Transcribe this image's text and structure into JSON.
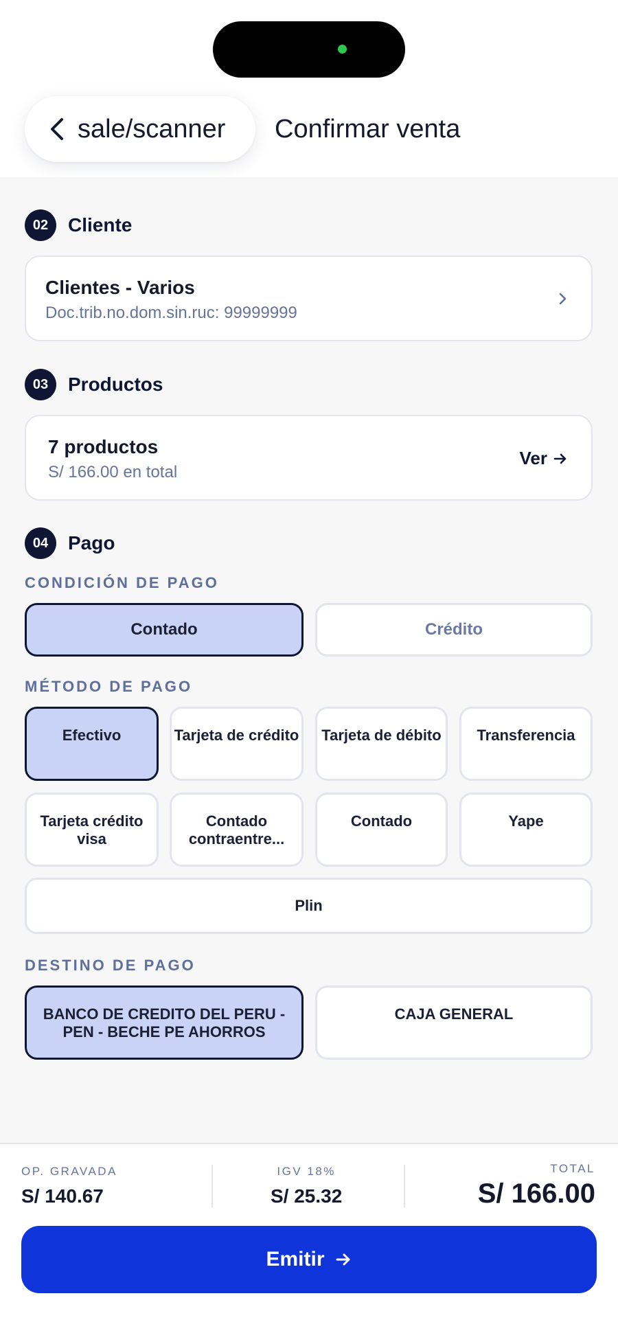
{
  "header": {
    "back_label": "sale/scanner",
    "title": "Confirmar venta"
  },
  "cliente": {
    "step": "02",
    "label": "Cliente",
    "name": "Clientes - Varios",
    "doc": "Doc.trib.no.dom.sin.ruc: 99999999"
  },
  "productos": {
    "step": "03",
    "label": "Productos",
    "count": "7 productos",
    "total": "S/ 166.00 en total",
    "ver": "Ver"
  },
  "pago": {
    "step": "04",
    "label": "Pago",
    "condicion_label": "CONDICIÓN DE PAGO",
    "condiciones": [
      "Contado",
      "Crédito"
    ],
    "condicion_selected": "Contado",
    "metodo_label": "MÉTODO DE PAGO",
    "metodos": [
      "Efectivo",
      "Tarjeta de crédito",
      "Tarjeta de débito",
      "Transferencia",
      "Tarjeta crédito visa",
      "Contado contraentre...",
      "Contado",
      "Yape",
      "Plin"
    ],
    "metodo_selected": "Efectivo",
    "destino_label": "DESTINO DE PAGO",
    "destinos": [
      "BANCO DE CREDITO DEL PERU - PEN - BECHE PE AHORROS",
      "CAJA GENERAL"
    ],
    "destino_selected": "BANCO DE CREDITO DEL PERU - PEN - BECHE PE AHORROS"
  },
  "footer": {
    "op_gravada_label": "OP. GRAVADA",
    "op_gravada_value": "S/ 140.67",
    "igv_label": "IGV 18%",
    "igv_value": "S/ 25.32",
    "total_label": "TOTAL",
    "total_value": "S/ 166.00",
    "emit_label": "Emitir"
  },
  "colors": {
    "primary": "#0f35da",
    "navy": "#0f1634",
    "selected_bg": "#c8d3f5",
    "status_dot": "#2fc84e"
  }
}
